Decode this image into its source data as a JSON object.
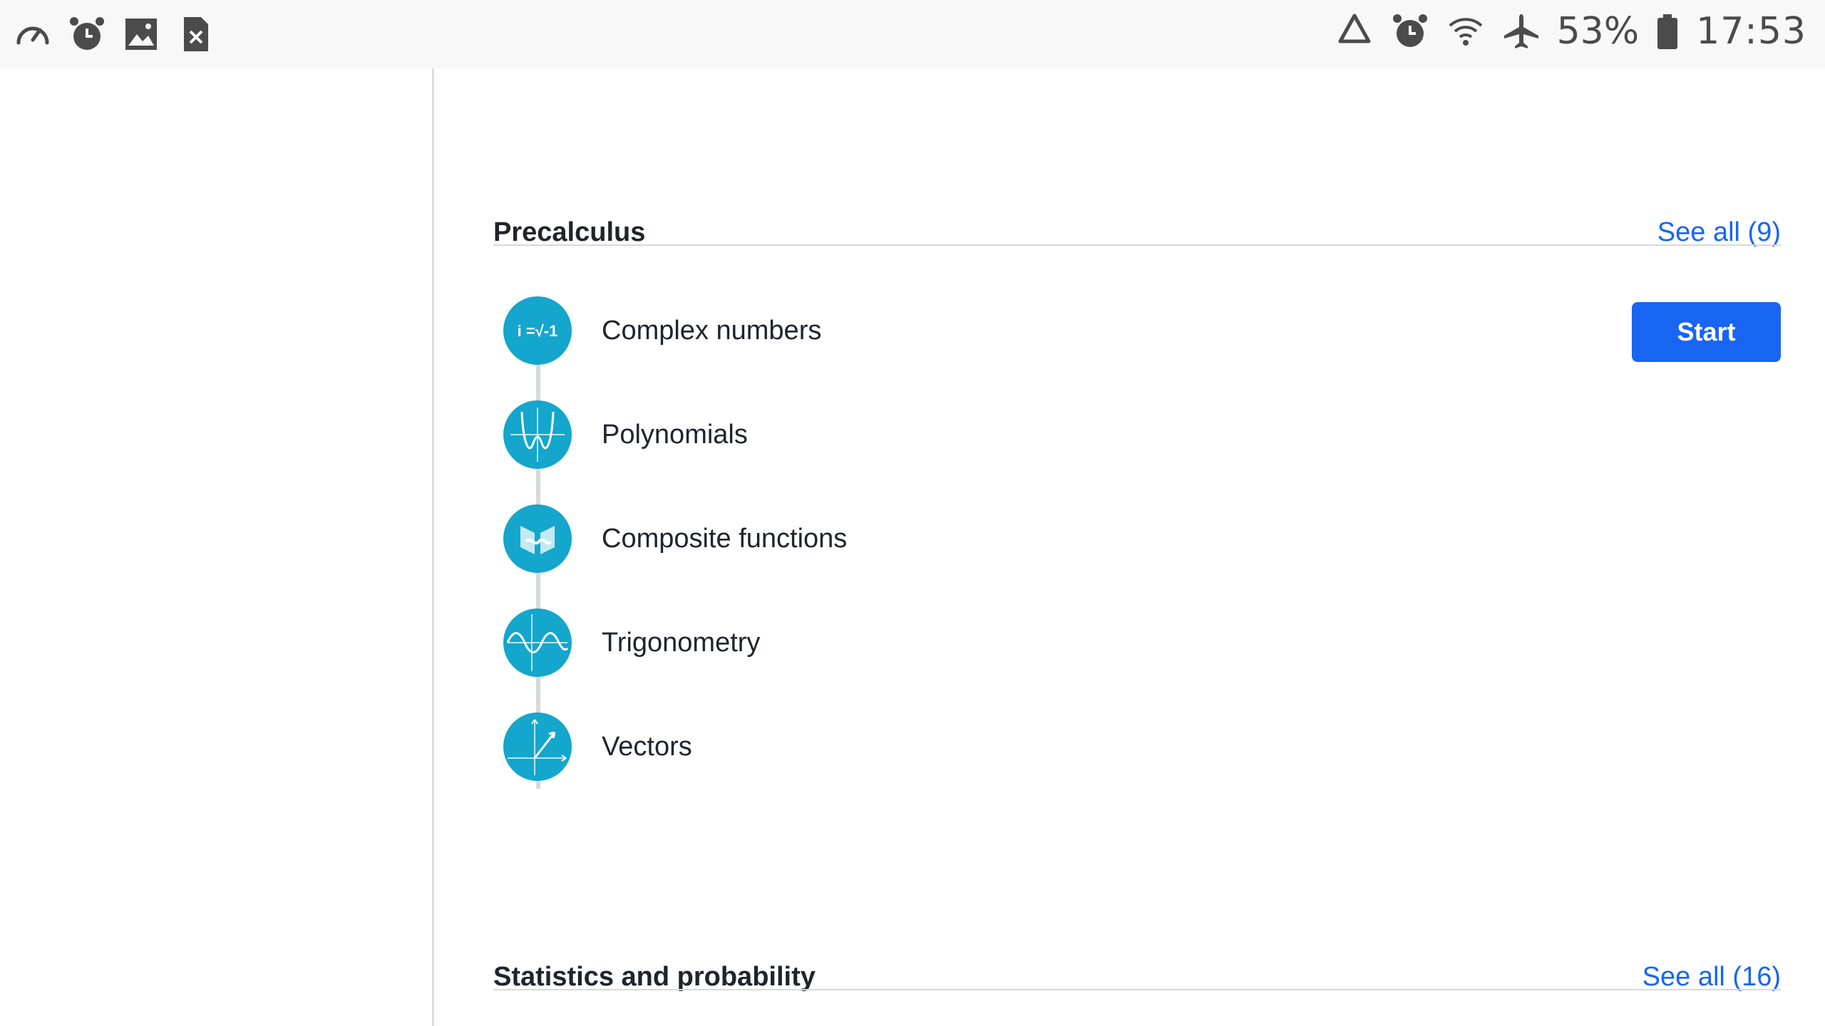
{
  "status_bar": {
    "left_icons": [
      "speedometer-icon",
      "alarm-icon",
      "image-icon",
      "sim-error-icon"
    ],
    "right_icons": [
      "recycle-icon",
      "alarm-icon",
      "wifi-icon",
      "airplane-icon",
      "battery-icon"
    ],
    "battery_percent": "53%",
    "time": "17:53"
  },
  "sections": [
    {
      "title": "Precalculus",
      "see_all": "See all (9)",
      "units": [
        {
          "label": "Complex numbers",
          "icon": "complex-numbers-icon",
          "icon_text": "i =√-1"
        },
        {
          "label": "Polynomials",
          "icon": "polynomials-icon"
        },
        {
          "label": "Composite functions",
          "icon": "composite-functions-icon"
        },
        {
          "label": "Trigonometry",
          "icon": "trigonometry-icon"
        },
        {
          "label": "Vectors",
          "icon": "vectors-icon"
        }
      ],
      "start_label": "Start"
    },
    {
      "title": "Statistics and probability",
      "see_all": "See all (16)"
    }
  ],
  "colors": {
    "accent": "#1865f2",
    "icon_bg": "#14a6cc",
    "text": "#21242c",
    "divider": "#d6d8da"
  }
}
